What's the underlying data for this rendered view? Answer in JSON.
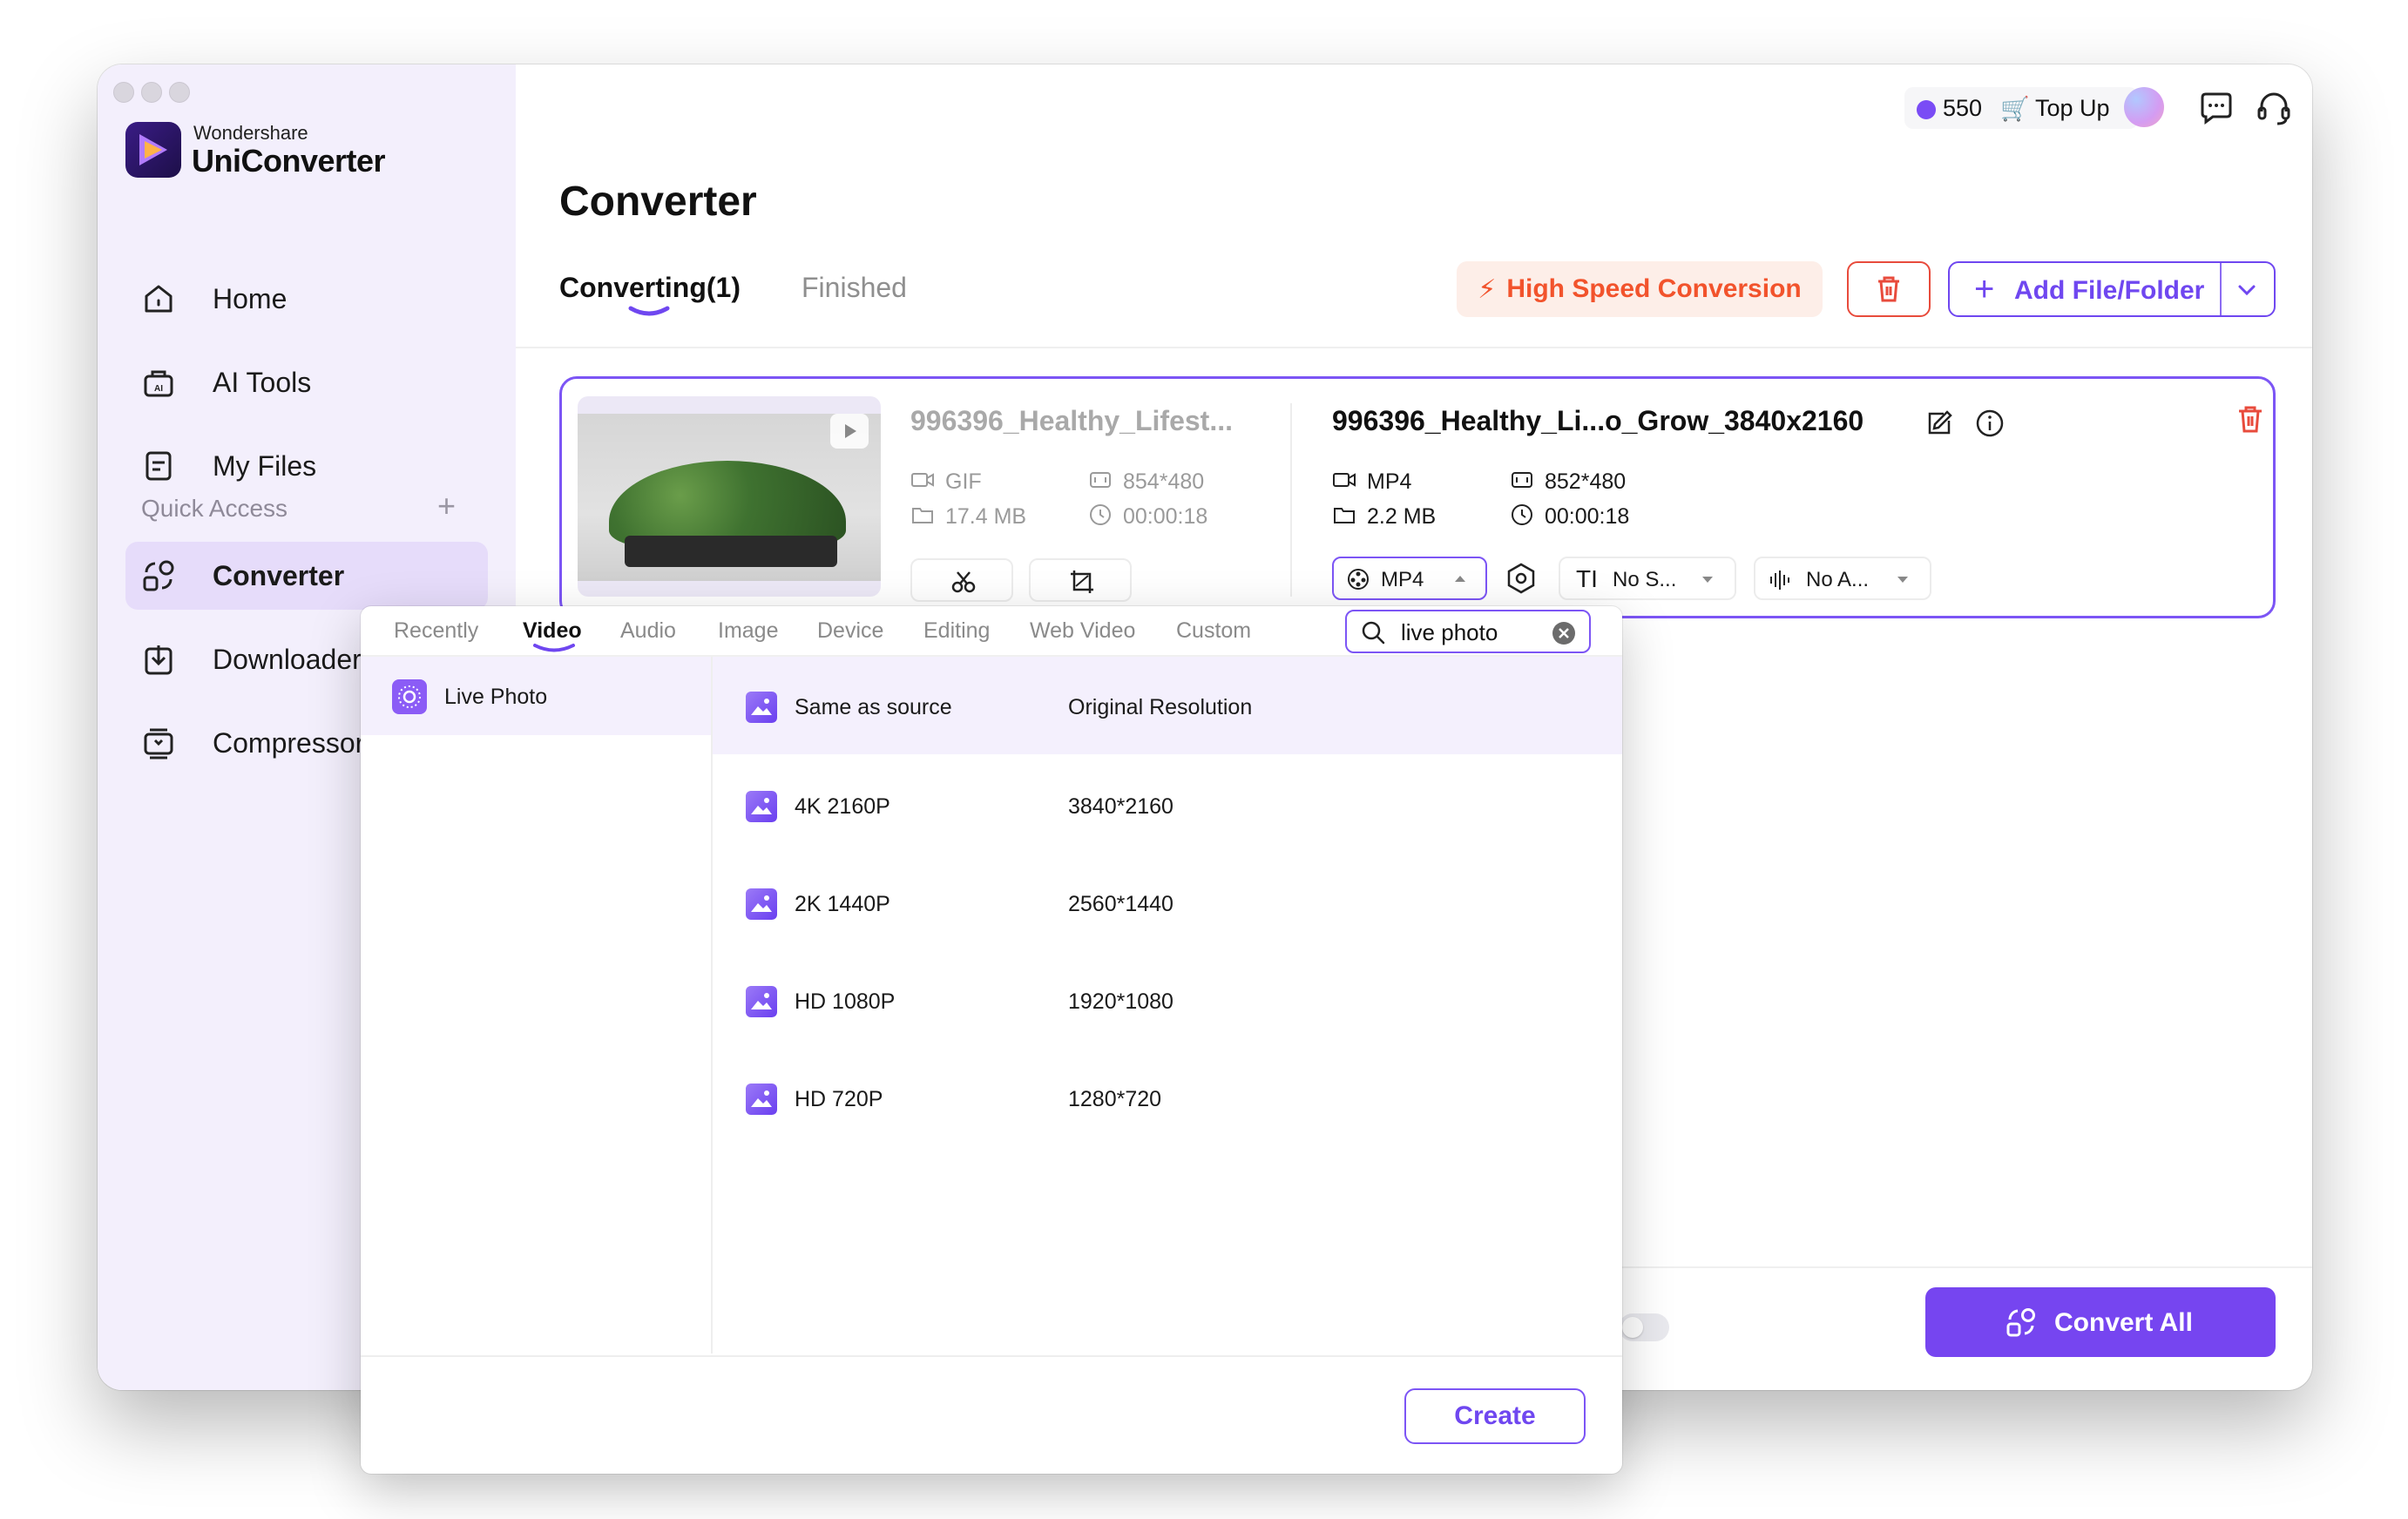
{
  "brand": {
    "company": "Wondershare",
    "product": "UniConverter"
  },
  "sidebar": {
    "items": [
      {
        "label": "Home",
        "icon": "home-icon"
      },
      {
        "label": "AI Tools",
        "icon": "ai-tools-icon"
      },
      {
        "label": "My Files",
        "icon": "my-files-icon"
      },
      {
        "label": "Converter",
        "icon": "converter-icon",
        "active": true
      },
      {
        "label": "Downloader",
        "icon": "downloader-icon"
      },
      {
        "label": "Compressor",
        "icon": "compressor-icon"
      }
    ],
    "quick_access": "Quick Access"
  },
  "topbar": {
    "credits": "550",
    "top_up": "Top Up"
  },
  "page": {
    "title": "Converter",
    "tabs": [
      "Converting(1)",
      "Finished"
    ],
    "high_speed": "High Speed Conversion",
    "add_file": "Add File/Folder"
  },
  "file": {
    "source": {
      "name": "996396_Healthy_Lifest...",
      "format": "GIF",
      "resolution": "854*480",
      "size": "17.4 MB",
      "duration": "00:00:18"
    },
    "target": {
      "name": "996396_Healthy_Li...o_Grow_3840x2160",
      "format": "MP4",
      "resolution": "852*480",
      "size": "2.2 MB",
      "duration": "00:00:18",
      "format_select": "MP4",
      "subtitle_select": "No S...",
      "audio_select": "No A..."
    }
  },
  "popup": {
    "tabs": [
      "Recently",
      "Video",
      "Audio",
      "Image",
      "Device",
      "Editing",
      "Web Video",
      "Custom"
    ],
    "active_tab": "Video",
    "search_value": "live photo",
    "category": "Live Photo",
    "presets": [
      {
        "name": "Same as source",
        "resolution": "Original Resolution"
      },
      {
        "name": "4K 2160P",
        "resolution": "3840*2160"
      },
      {
        "name": "2K 1440P",
        "resolution": "2560*1440"
      },
      {
        "name": "HD 1080P",
        "resolution": "1920*1080"
      },
      {
        "name": "HD 720P",
        "resolution": "1280*720"
      }
    ],
    "create": "Create"
  },
  "bottom": {
    "convert_all": "Convert All"
  },
  "colors": {
    "accent": "#7645f0",
    "danger": "#e84b3c",
    "orange": "#f2532c",
    "sidebar_bg": "#f3effc"
  }
}
